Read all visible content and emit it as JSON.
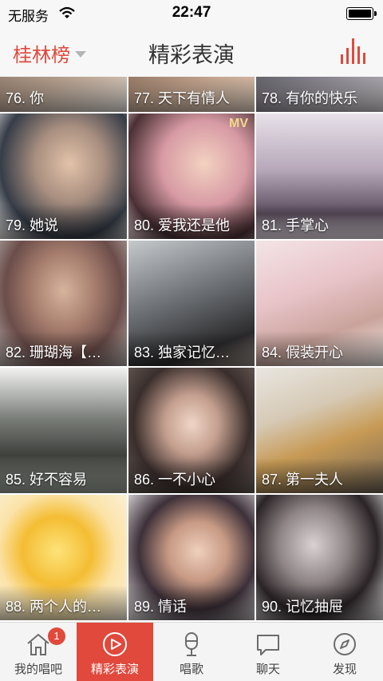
{
  "status_bar": {
    "carrier": "无服务",
    "time": "22:47"
  },
  "nav": {
    "city": "桂林榜",
    "title": "精彩表演"
  },
  "colors": {
    "accent": "#e0493c"
  },
  "tiles": [
    {
      "caption": "76. 你",
      "mv": ""
    },
    {
      "caption": "77. 天下有情人",
      "mv": ""
    },
    {
      "caption": "78. 有你的快乐",
      "mv": ""
    },
    {
      "caption": "79. 她说",
      "mv": ""
    },
    {
      "caption": "80. 爱我还是他",
      "mv": "MV"
    },
    {
      "caption": "81. 手掌心",
      "mv": ""
    },
    {
      "caption": "82. 珊瑚海【…",
      "mv": ""
    },
    {
      "caption": "83. 独家记忆…",
      "mv": ""
    },
    {
      "caption": "84. 假装开心",
      "mv": ""
    },
    {
      "caption": "85. 好不容易",
      "mv": ""
    },
    {
      "caption": "86. 一不小心",
      "mv": ""
    },
    {
      "caption": "87. 第一夫人",
      "mv": ""
    },
    {
      "caption": "88. 两个人的…",
      "mv": ""
    },
    {
      "caption": "89. 情话",
      "mv": ""
    },
    {
      "caption": "90. 记忆抽屉",
      "mv": ""
    }
  ],
  "tabs": [
    {
      "label": "我的唱吧",
      "icon": "home-icon",
      "badge": "1"
    },
    {
      "label": "精彩表演",
      "icon": "play-icon"
    },
    {
      "label": "唱歌",
      "icon": "microphone-icon"
    },
    {
      "label": "聊天",
      "icon": "chat-icon"
    },
    {
      "label": "发现",
      "icon": "discover-icon"
    }
  ]
}
